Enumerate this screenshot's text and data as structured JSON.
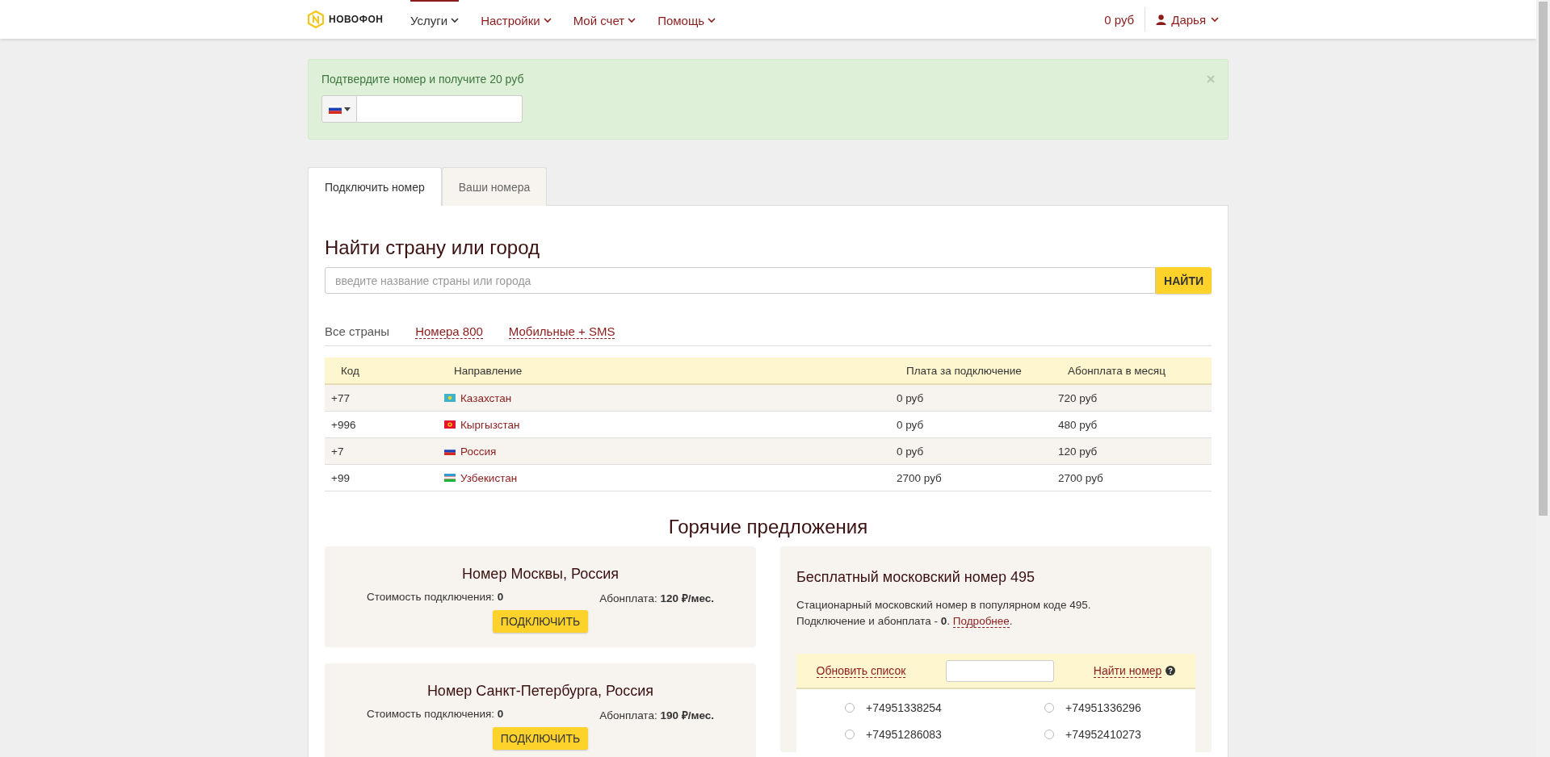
{
  "header": {
    "logo": "НОВОФОН",
    "nav": [
      {
        "label": "Услуги",
        "selected": true
      },
      {
        "label": "Настройки",
        "selected": false
      },
      {
        "label": "Мой счет",
        "selected": false
      },
      {
        "label": "Помощь",
        "selected": false
      }
    ],
    "balance": "0 руб",
    "user": "Дарья"
  },
  "alert": {
    "message": "Подтвердите номер и получите 20 руб"
  },
  "tabs": [
    {
      "label": "Подключить номер",
      "selected": true
    },
    {
      "label": "Ваши номера",
      "selected": false
    }
  ],
  "search": {
    "title": "Найти страну или город",
    "placeholder": "введите название страны или города",
    "button": "НАЙТИ"
  },
  "filters": [
    {
      "label": "Все страны",
      "selected": true
    },
    {
      "label": "Номера 800",
      "selected": false
    },
    {
      "label": "Мобильные + SMS",
      "selected": false
    }
  ],
  "table": {
    "columns": [
      "Код",
      "Направление",
      "Плата за подключение",
      "Абонплата в месяц"
    ],
    "rows": [
      {
        "code": "+77",
        "kind": "kz",
        "direction": "Казахстан",
        "connection": "0 руб",
        "monthly": "720 руб"
      },
      {
        "code": "+996",
        "kind": "kg",
        "direction": "Кыргызстан",
        "connection": "0 руб",
        "monthly": "480 руб"
      },
      {
        "code": "+7",
        "kind": "ru",
        "direction": "Россия",
        "connection": "0 руб",
        "monthly": "120 руб"
      },
      {
        "code": "+99",
        "kind": "uz",
        "direction": "Узбекистан",
        "connection": "2700 руб",
        "monthly": "2700 руб"
      }
    ]
  },
  "hot_offers": {
    "title": "Горячие предложения",
    "cards": [
      {
        "title": "Номер Москвы, Россия",
        "connection": "Стоимость подключения: **0**",
        "fee": "Абонплата: **120 ₽/мес.**",
        "button": "ПОДКЛЮЧИТЬ"
      },
      {
        "title": "Номер Санкт-Петербурга, Россия",
        "connection": "Стоимость подключения: **0**",
        "fee": "Абонплата: **190 ₽/мес.**",
        "button": "ПОДКЛЮЧИТЬ"
      }
    ]
  },
  "free_number": {
    "title": "Бесплатный московский номер 495",
    "description": "Стационарный московский номер в популярном коде 495.",
    "terms": "Подключение и абонплата - **0**. ",
    "link": "Подробнее",
    "after": ".",
    "refresh": "Обновить список",
    "find": "Найти номер",
    "numbers": [
      {
        "number": "+74951338254",
        "selected": false
      },
      {
        "number": "+74951336296",
        "selected": false
      },
      {
        "number": "+74951286083",
        "selected": false
      },
      {
        "number": "+74952410273",
        "selected": false
      }
    ]
  }
}
